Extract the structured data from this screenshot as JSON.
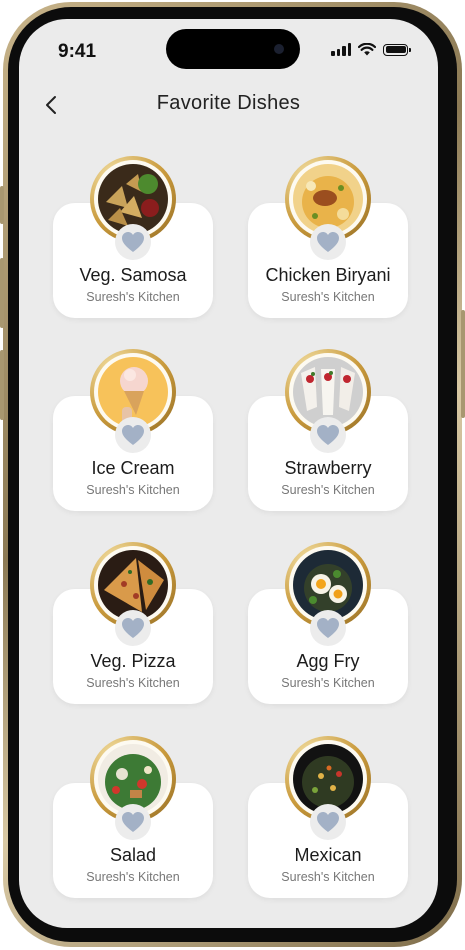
{
  "status": {
    "time": "9:41"
  },
  "header": {
    "title": "Favorite Dishes"
  },
  "dishes": [
    {
      "name": "Veg. Samosa",
      "kitchen": "Suresh's Kitchen",
      "image": "samosa-photo"
    },
    {
      "name": "Chicken Biryani",
      "kitchen": "Suresh's Kitchen",
      "image": "biryani-photo"
    },
    {
      "name": "Ice Cream",
      "kitchen": "Suresh's Kitchen",
      "image": "ice-cream-photo"
    },
    {
      "name": "Strawberry",
      "kitchen": "Suresh's Kitchen",
      "image": "strawberry-wraps-photo"
    },
    {
      "name": "Veg. Pizza",
      "kitchen": "Suresh's Kitchen",
      "image": "pizza-photo"
    },
    {
      "name": "Agg Fry",
      "kitchen": "Suresh's Kitchen",
      "image": "egg-fry-photo"
    },
    {
      "name": "Salad",
      "kitchen": "Suresh's Kitchen",
      "image": "salad-photo"
    },
    {
      "name": "Mexican",
      "kitchen": "Suresh's Kitchen",
      "image": "mexican-photo"
    }
  ],
  "colors": {
    "heart": "#a3b1c6",
    "screen_bg": "#ebebeb",
    "card_bg": "#ffffff",
    "ring_gold": "#c99a3c"
  },
  "icons": {
    "back": "chevron-left-icon",
    "favorite": "heart-icon",
    "signal": "signal-icon",
    "wifi": "wifi-icon",
    "battery": "battery-icon"
  }
}
